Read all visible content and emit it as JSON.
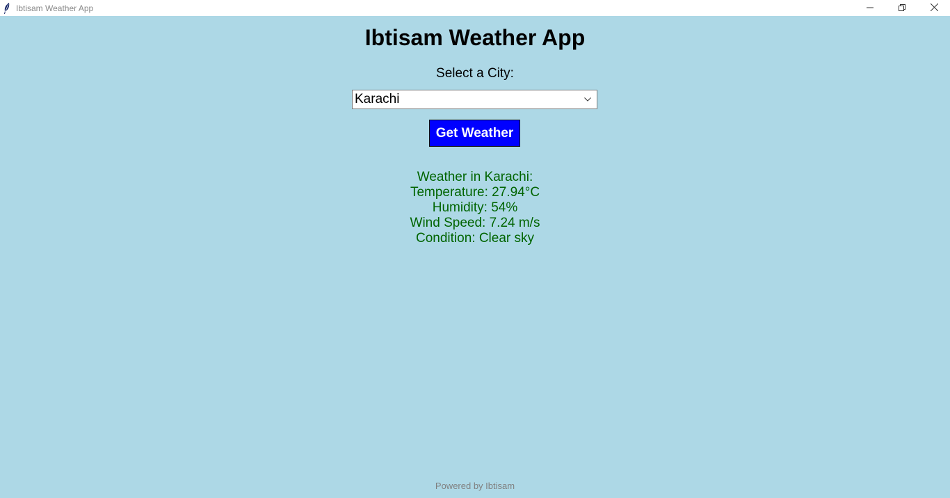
{
  "window": {
    "title": "Ibtisam Weather App",
    "controls": [
      "minimize-icon",
      "restore-icon",
      "close-icon"
    ]
  },
  "app": {
    "heading": "Ibtisam Weather App",
    "city_label": "Select a City:",
    "city_select": {
      "value": "Karachi"
    },
    "button_label": "Get Weather"
  },
  "weather": {
    "title": "Weather in Karachi:",
    "temperature": "Temperature: 27.94°C",
    "humidity": "Humidity: 54%",
    "wind": "Wind Speed: 7.24 m/s",
    "condition": "Condition: Clear sky"
  },
  "footer": {
    "text": "Powered by Ibtisam"
  },
  "colors": {
    "background": "#add8e6",
    "button": "#0000ff",
    "weather_text": "#006400",
    "footer_text": "#808080"
  }
}
